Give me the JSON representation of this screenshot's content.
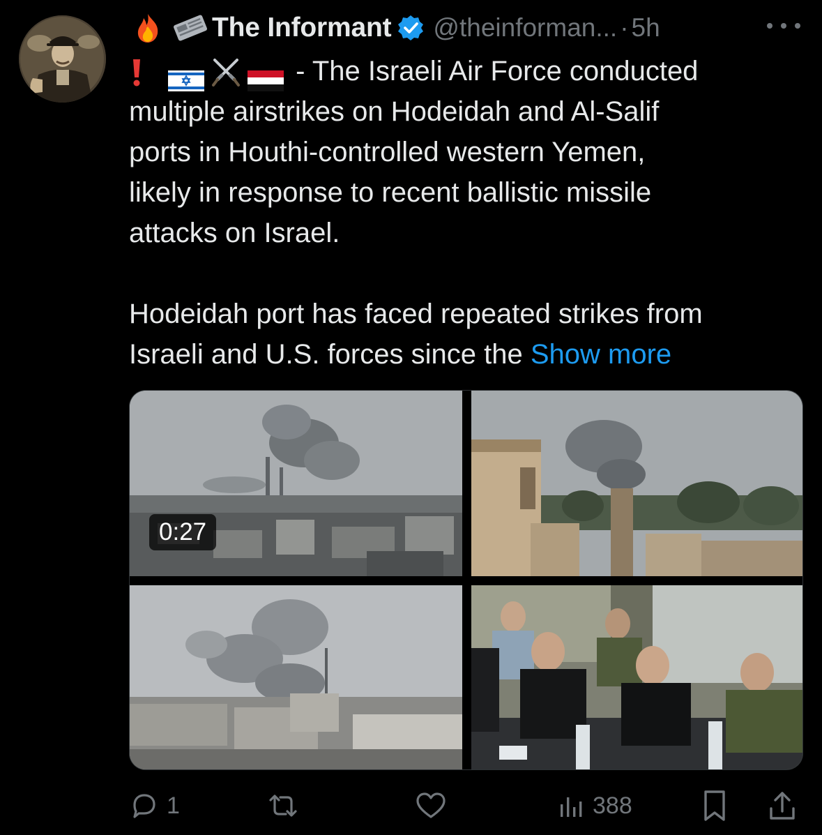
{
  "tweet": {
    "author": {
      "display_name": "The Informant",
      "handle": "@theinforman...",
      "verified": true,
      "avatar": "vintage-portrait-avatar",
      "name_emojis": [
        "fire-emoji",
        "newspaper-emoji"
      ]
    },
    "separator": "·",
    "time_ago": "5h",
    "more_icon": "more-dots-icon",
    "text": {
      "prefix_emojis": [
        "exclamation-emoji",
        "israel-flag",
        "crossed-swords-emoji",
        "yemen-flag"
      ],
      "line1": "- The Israeli Air Force conducted",
      "line2": "multiple airstrikes on Hodeidah and Al-Salif",
      "line3": "ports in Houthi-controlled western Yemen,",
      "line4": "likely in response to recent ballistic missile",
      "line5": "attacks on Israel.",
      "line6": "Hodeidah port has faced repeated strikes from",
      "line7": "Israeli and U.S. forces since the",
      "show_more": "Show more"
    },
    "media": {
      "video_duration": "0:27",
      "tiles": [
        "smoke-over-port-city-video",
        "smoke-behind-yemeni-tower",
        "smoke-plume-over-buildings",
        "officials-in-command-room"
      ]
    },
    "actions": {
      "reply_count": "1",
      "retweet_count": "",
      "like_count": "",
      "views_count": "388"
    },
    "colors": {
      "background": "#000000",
      "text": "#e7e9ea",
      "muted": "#71767b",
      "link": "#1d9bf0",
      "verified": "#1d9bf0"
    }
  }
}
